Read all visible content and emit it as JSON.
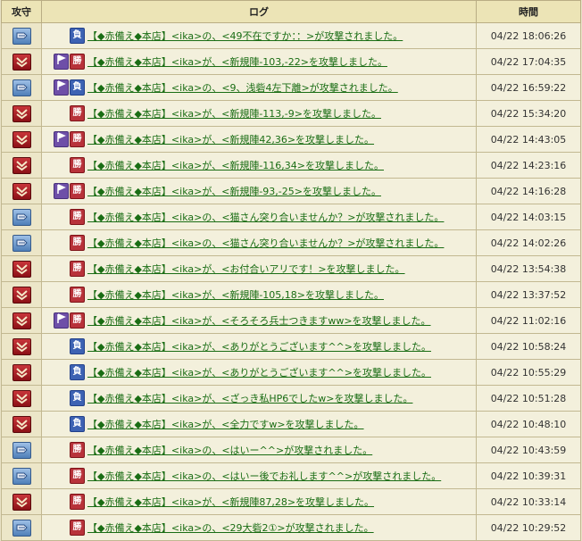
{
  "headers": {
    "type": "攻守",
    "log": "ログ",
    "time": "時間"
  },
  "colors": {
    "attack": "#b8323a",
    "defense": "#5b86c0",
    "win": "#b8323a",
    "lose": "#3d62b3",
    "flag": "#6e4fa8",
    "link": "#1a6d14"
  },
  "rows": [
    {
      "type": "defense",
      "flag": false,
      "result": "負",
      "text": "【◆赤備え◆本店】<ika>の、<49不在ですか：：>が攻撃されました。",
      "time": "04/22 18:06:26"
    },
    {
      "type": "attack",
      "flag": true,
      "result": "勝",
      "text": "【◆赤備え◆本店】<ika>が、<新規陣-103,-22>を攻撃しました。",
      "time": "04/22 17:04:35"
    },
    {
      "type": "defense",
      "flag": true,
      "result": "負",
      "text": "【◆赤備え◆本店】<ika>の、<9、浅砦4左下離>が攻撃されました。",
      "time": "04/22 16:59:22"
    },
    {
      "type": "attack",
      "flag": false,
      "result": "勝",
      "text": "【◆赤備え◆本店】<ika>が、<新規陣-113,-9>を攻撃しました。",
      "time": "04/22 15:34:20"
    },
    {
      "type": "attack",
      "flag": true,
      "result": "勝",
      "text": "【◆赤備え◆本店】<ika>が、<新規陣42,36>を攻撃しました。",
      "time": "04/22 14:43:05"
    },
    {
      "type": "attack",
      "flag": false,
      "result": "勝",
      "text": "【◆赤備え◆本店】<ika>が、<新規陣-116,34>を攻撃しました。",
      "time": "04/22 14:23:16"
    },
    {
      "type": "attack",
      "flag": true,
      "result": "勝",
      "text": "【◆赤備え◆本店】<ika>が、<新規陣-93,-25>を攻撃しました。",
      "time": "04/22 14:16:28"
    },
    {
      "type": "defense",
      "flag": false,
      "result": "勝",
      "text": "【◆赤備え◆本店】<ika>の、<猫さん突り合いませんか？>が攻撃されました。",
      "time": "04/22 14:03:15"
    },
    {
      "type": "defense",
      "flag": false,
      "result": "勝",
      "text": "【◆赤備え◆本店】<ika>の、<猫さん突り合いませんか？>が攻撃されました。",
      "time": "04/22 14:02:26"
    },
    {
      "type": "attack",
      "flag": false,
      "result": "勝",
      "text": "【◆赤備え◆本店】<ika>が、<お付合いアリです！>を攻撃しました。",
      "time": "04/22 13:54:38"
    },
    {
      "type": "attack",
      "flag": false,
      "result": "勝",
      "text": "【◆赤備え◆本店】<ika>が、<新規陣-105,18>を攻撃しました。",
      "time": "04/22 13:37:52"
    },
    {
      "type": "attack",
      "flag": true,
      "result": "勝",
      "text": "【◆赤備え◆本店】<ika>が、<そろそろ兵士つきますww>を攻撃しました。",
      "time": "04/22 11:02:16"
    },
    {
      "type": "attack",
      "flag": false,
      "result": "負",
      "text": "【◆赤備え◆本店】<ika>が、<ありがとうございます^^>を攻撃しました。",
      "time": "04/22 10:58:24"
    },
    {
      "type": "attack",
      "flag": false,
      "result": "負",
      "text": "【◆赤備え◆本店】<ika>が、<ありがとうございます^^>を攻撃しました。",
      "time": "04/22 10:55:29"
    },
    {
      "type": "attack",
      "flag": false,
      "result": "負",
      "text": "【◆赤備え◆本店】<ika>が、<ざっき私HP6でしたw>を攻撃しました。",
      "time": "04/22 10:51:28"
    },
    {
      "type": "attack",
      "flag": false,
      "result": "負",
      "text": "【◆赤備え◆本店】<ika>が、<全力ですw>を攻撃しました。",
      "time": "04/22 10:48:10"
    },
    {
      "type": "defense",
      "flag": false,
      "result": "勝",
      "text": "【◆赤備え◆本店】<ika>の、<はいー^^>が攻撃されました。",
      "time": "04/22 10:43:59"
    },
    {
      "type": "defense",
      "flag": false,
      "result": "勝",
      "text": "【◆赤備え◆本店】<ika>の、<はいー後でお礼します^^>が攻撃されました。",
      "time": "04/22 10:39:31"
    },
    {
      "type": "attack",
      "flag": false,
      "result": "勝",
      "text": "【◆赤備え◆本店】<ika>が、<新規陣87,28>を攻撃しました。",
      "time": "04/22 10:33:14"
    },
    {
      "type": "defense",
      "flag": false,
      "result": "勝",
      "text": "【◆赤備え◆本店】<ika>の、<29大砦2①>が攻撃されました。",
      "time": "04/22 10:29:52"
    }
  ]
}
